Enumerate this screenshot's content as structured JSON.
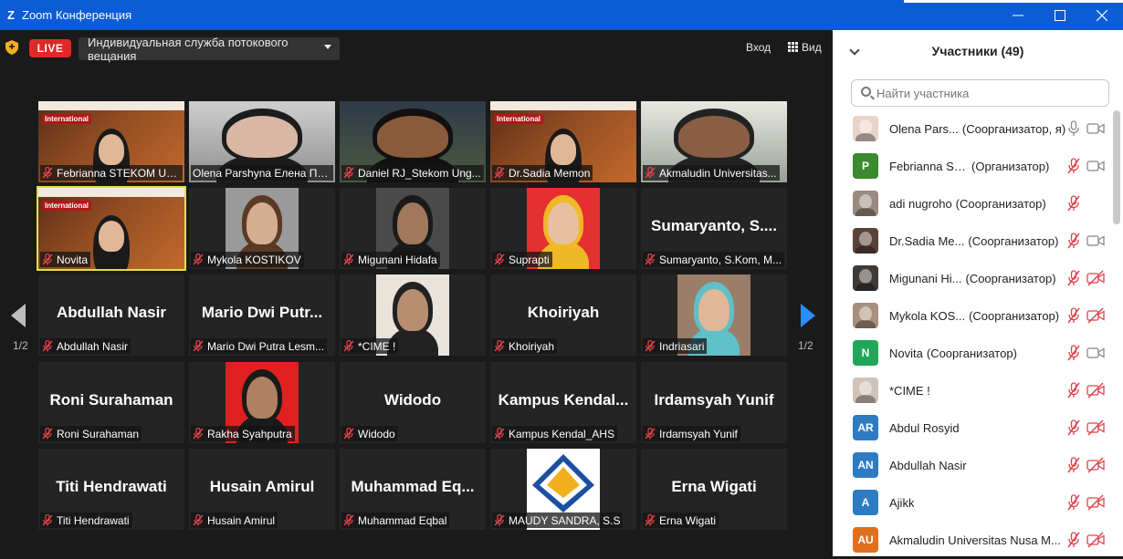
{
  "window": {
    "title": "Zoom Конференция"
  },
  "toolbar": {
    "live_label": "LIVE",
    "stream_service": "Индивидуальная служба потокового вещания",
    "enter_label": "Вход",
    "view_label": "Вид"
  },
  "gallery": {
    "page_left": "1/2",
    "page_right": "1/2",
    "tiles": [
      {
        "name": "Febrianna STEKOM Un...",
        "big": "",
        "muted": true
      },
      {
        "name": "Olena Parshyna Елена Па...",
        "big": "",
        "muted": false
      },
      {
        "name": "Daniel RJ_Stekom Ung...",
        "big": "",
        "muted": true
      },
      {
        "name": "Dr.Sadia Memon",
        "big": "",
        "muted": true
      },
      {
        "name": "Akmaludin Universitas...",
        "big": "",
        "muted": true
      },
      {
        "name": "Novita",
        "big": "",
        "muted": true
      },
      {
        "name": "Mykola KOSTIKOV",
        "big": "",
        "muted": true
      },
      {
        "name": "Migunani Hidafa",
        "big": "",
        "muted": true
      },
      {
        "name": "Suprapti",
        "big": "",
        "muted": true
      },
      {
        "name": "Sumaryanto, S.Kom, M...",
        "big": "Sumaryanto,  S....",
        "muted": true
      },
      {
        "name": "Abdullah Nasir",
        "big": "Abdullah Nasir",
        "muted": true
      },
      {
        "name": "Mario Dwi Putra Lesm...",
        "big": "Mario  Dwi  Putr...",
        "muted": true
      },
      {
        "name": "*CIME !",
        "big": "",
        "muted": true
      },
      {
        "name": "Khoiriyah",
        "big": "Khoiriyah",
        "muted": true
      },
      {
        "name": "Indriasari",
        "big": "",
        "muted": true
      },
      {
        "name": "Roni Surahaman",
        "big": "Roni Surahaman",
        "muted": true
      },
      {
        "name": "Rakha Syahputra",
        "big": "",
        "muted": true
      },
      {
        "name": "Widodo",
        "big": "Widodo",
        "muted": true
      },
      {
        "name": "Kampus Kendal_AHS",
        "big": "Kampus  Kendal...",
        "muted": true
      },
      {
        "name": "Irdamsyah Yunif",
        "big": "Irdamsyah Yunif",
        "muted": true
      },
      {
        "name": "Titi Hendrawati",
        "big": "Titi Hendrawati",
        "muted": true
      },
      {
        "name": "Husain Amirul",
        "big": "Husain Amirul",
        "muted": true
      },
      {
        "name": "Muhammad Eqbal",
        "big": "Muhammad  Eq...",
        "muted": true
      },
      {
        "name": "MAUDY SANDRA, S.S",
        "big": "",
        "muted": true
      },
      {
        "name": "Erna Wigati",
        "big": "Erna Wigati",
        "muted": true
      }
    ],
    "banner_label": "International"
  },
  "panel": {
    "title": "Участники (49)",
    "search_placeholder": "Найти участника",
    "participants": [
      {
        "name": "Olena Pars...",
        "role": "(Соорганизатор, я)",
        "avatar": "",
        "color": "#e8d4c8",
        "mic": "on",
        "cam": "on"
      },
      {
        "name": "Febrianna STEK...",
        "role": "(Организатор)",
        "avatar": "P",
        "color": "#3c8a2e",
        "mic": "off",
        "cam": "on"
      },
      {
        "name": "adi nugroho",
        "role": "(Соорганизатор)",
        "avatar": "",
        "color": "#9a8a80",
        "mic": "off",
        "cam": "none"
      },
      {
        "name": "Dr.Sadia Me...",
        "role": "(Соорганизатор)",
        "avatar": "",
        "color": "#5a4238",
        "mic": "off",
        "cam": "on"
      },
      {
        "name": "Migunani Hi...",
        "role": "(Соорганизатор)",
        "avatar": "",
        "color": "#3e3a38",
        "mic": "off",
        "cam": "off"
      },
      {
        "name": "Mykola KOS...",
        "role": "(Соорганизатор)",
        "avatar": "",
        "color": "#a8907c",
        "mic": "off",
        "cam": "off"
      },
      {
        "name": "Novita",
        "role": "(Соорганизатор)",
        "avatar": "N",
        "color": "#23a55a",
        "mic": "off",
        "cam": "on"
      },
      {
        "name": "*CIME !",
        "role": "",
        "avatar": "",
        "color": "#cfc2b8",
        "mic": "off",
        "cam": "off"
      },
      {
        "name": "Abdul Rosyid",
        "role": "",
        "avatar": "AR",
        "color": "#2e7bc4",
        "mic": "off",
        "cam": "off"
      },
      {
        "name": "Abdullah Nasir",
        "role": "",
        "avatar": "AN",
        "color": "#2e7bc4",
        "mic": "off",
        "cam": "off"
      },
      {
        "name": "Ajikk",
        "role": "",
        "avatar": "A",
        "color": "#2e7bc4",
        "mic": "off",
        "cam": "off"
      },
      {
        "name": "Akmaludin Universitas Nusa M...",
        "role": "",
        "avatar": "AU",
        "color": "#e0701e",
        "mic": "off",
        "cam": "off"
      }
    ]
  },
  "colors": {
    "titlebar": "#0b5cd5",
    "live": "#e02828",
    "muted": "#e0434a",
    "active_border": "#e3e04a",
    "pager": "#2d8cff"
  }
}
